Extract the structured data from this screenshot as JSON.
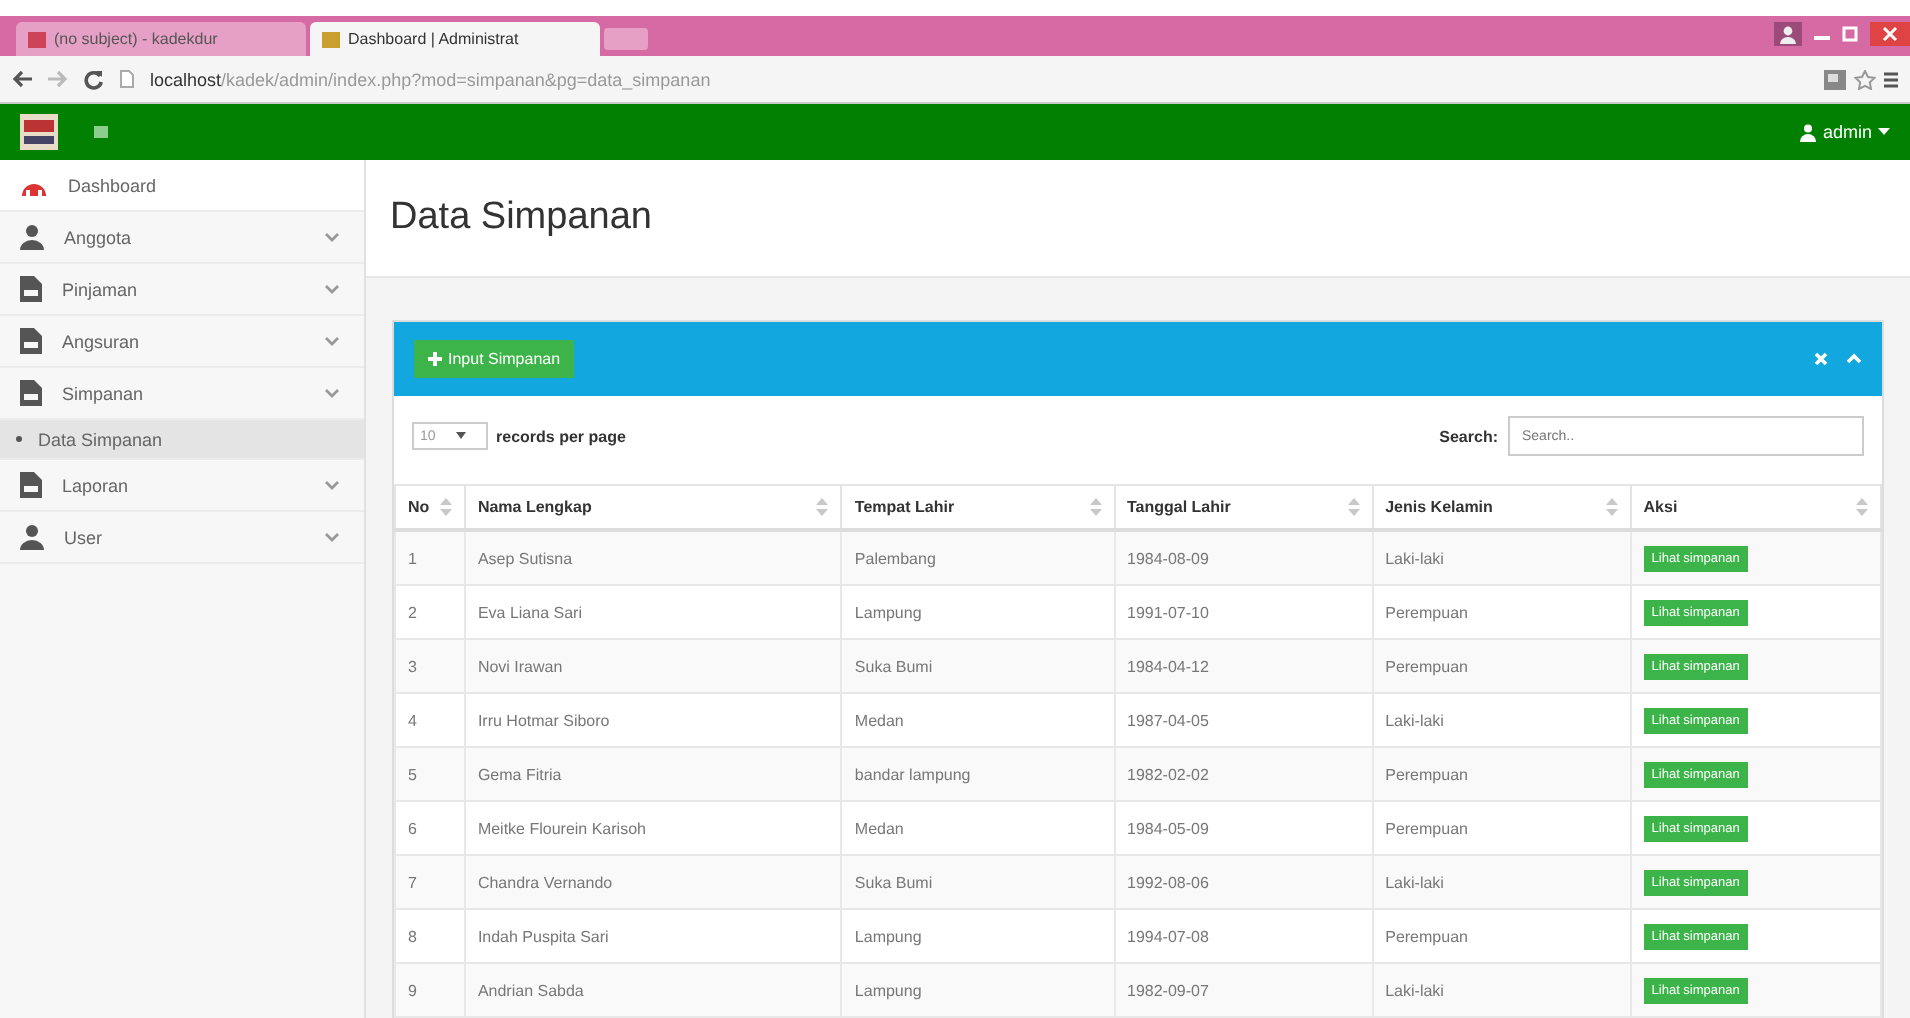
{
  "browser": {
    "tabs": [
      {
        "label": "(no subject) - kadekdur",
        "selected": false
      },
      {
        "label": "Dashboard | Administrat",
        "selected": true
      }
    ],
    "url_host": "localhost",
    "url_path": "/kadek/admin/index.php?mod=simpanan&pg=data_simpanan"
  },
  "navbar": {
    "user": "admin"
  },
  "sidebar": {
    "items": [
      {
        "label": "Dashboard",
        "kind": "dashboard",
        "submenu": false,
        "selected": false
      },
      {
        "label": "Anggota",
        "kind": "person",
        "submenu": true,
        "selected": false
      },
      {
        "label": "Pinjaman",
        "kind": "file",
        "submenu": true,
        "selected": false
      },
      {
        "label": "Angsuran",
        "kind": "file",
        "submenu": true,
        "selected": false
      },
      {
        "label": "Simpanan",
        "kind": "file",
        "submenu": true,
        "selected": false
      },
      {
        "label": "Data Simpanan",
        "kind": "sub",
        "submenu": false,
        "selected": true
      },
      {
        "label": "Laporan",
        "kind": "file",
        "submenu": true,
        "selected": false
      },
      {
        "label": "User",
        "kind": "person",
        "submenu": true,
        "selected": false
      }
    ]
  },
  "page_title": "Data Simpanan",
  "box": {
    "add_button": "Input Simpanan",
    "page_length": "10",
    "page_length_label": "records per page",
    "search_label": "Search:",
    "search_placeholder": "Search..",
    "columns": [
      "No",
      "Nama Lengkap",
      "Tempat Lahir",
      "Tanggal Lahir",
      "Jenis Kelamin",
      "Aksi"
    ],
    "rows": [
      {
        "no": "1",
        "nama": "Asep Sutisna",
        "tempat": "Palembang",
        "tanggal": "1984-08-09",
        "jenis": "Laki-laki",
        "aksi": "Lihat simpanan"
      },
      {
        "no": "2",
        "nama": "Eva Liana Sari",
        "tempat": "Lampung",
        "tanggal": "1991-07-10",
        "jenis": "Perempuan",
        "aksi": "Lihat simpanan"
      },
      {
        "no": "3",
        "nama": "Novi Irawan",
        "tempat": "Suka Bumi",
        "tanggal": "1984-04-12",
        "jenis": "Perempuan",
        "aksi": "Lihat simpanan"
      },
      {
        "no": "4",
        "nama": "Irru Hotmar Siboro",
        "tempat": "Medan",
        "tanggal": "1987-04-05",
        "jenis": "Laki-laki",
        "aksi": "Lihat simpanan"
      },
      {
        "no": "5",
        "nama": "Gema Fitria",
        "tempat": "bandar lampung",
        "tanggal": "1982-02-02",
        "jenis": "Perempuan",
        "aksi": "Lihat simpanan"
      },
      {
        "no": "6",
        "nama": "Meitke Flourein Karisoh",
        "tempat": "Medan",
        "tanggal": "1984-05-09",
        "jenis": "Perempuan",
        "aksi": "Lihat simpanan"
      },
      {
        "no": "7",
        "nama": "Chandra Vernando",
        "tempat": "Suka Bumi",
        "tanggal": "1992-08-06",
        "jenis": "Laki-laki",
        "aksi": "Lihat simpanan"
      },
      {
        "no": "8",
        "nama": "Indah Puspita Sari",
        "tempat": "Lampung",
        "tanggal": "1994-07-08",
        "jenis": "Perempuan",
        "aksi": "Lihat simpanan"
      },
      {
        "no": "9",
        "nama": "Andrian Sabda",
        "tempat": "Lampung",
        "tanggal": "1982-09-07",
        "jenis": "Laki-laki",
        "aksi": "Lihat simpanan"
      }
    ]
  }
}
